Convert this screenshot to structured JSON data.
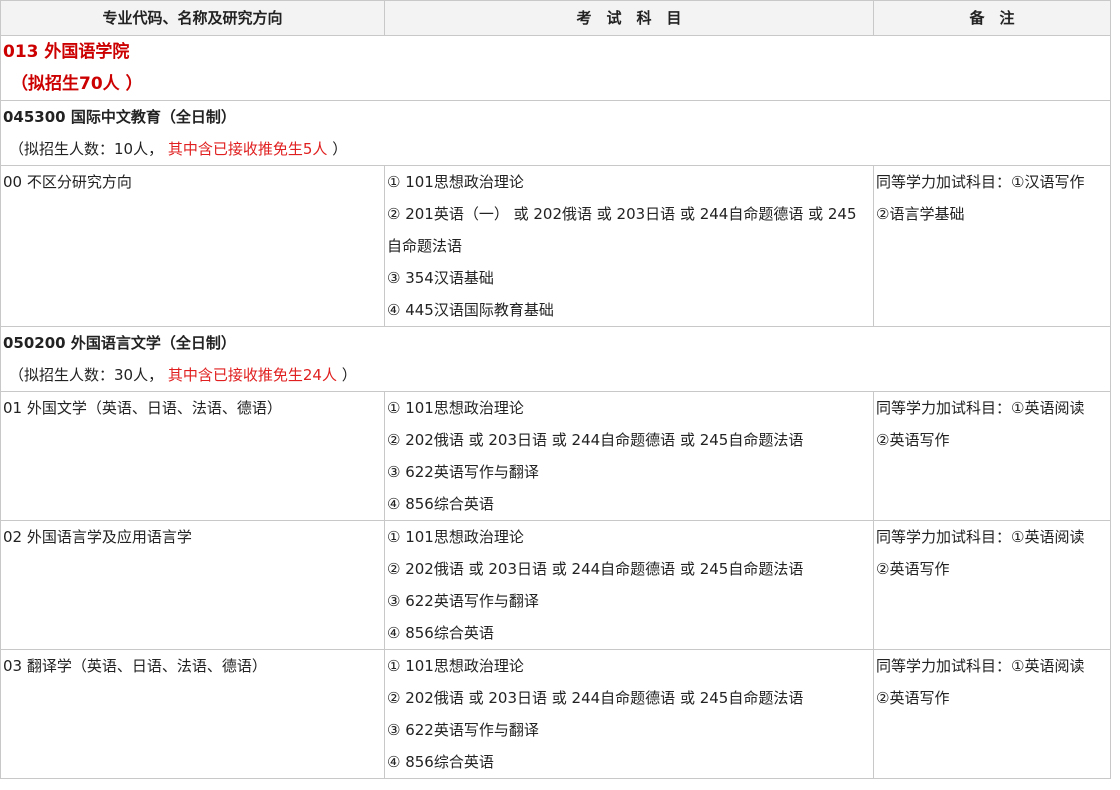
{
  "header": {
    "col1": "专业代码、名称及研究方向",
    "col2": "考　试　科　目",
    "col3": "备　注"
  },
  "college": {
    "name": "013 外国语学院",
    "quota": "（拟招生70人 ）"
  },
  "majors": [
    {
      "title": "045300 国际中文教育（全日制）",
      "quota_prefix": "（拟招生人数：10人，",
      "quota_red": "其中含已接收推免生5人",
      "quota_suffix": "）",
      "directions": [
        {
          "name": "00 不区分研究方向",
          "subjects": [
            "① 101思想政治理论",
            "② 201英语（一） 或 202俄语 或 203日语 或 244自命题德语 或 245自命题法语",
            "③ 354汉语基础",
            "④ 445汉语国际教育基础"
          ],
          "note": [
            "同等学力加试科目：①汉语写作",
            "②语言学基础"
          ]
        }
      ]
    },
    {
      "title": "050200 外国语言文学（全日制）",
      "quota_prefix": "（拟招生人数：30人，",
      "quota_red": "其中含已接收推免生24人",
      "quota_suffix": "）",
      "directions": [
        {
          "name": "01 外国文学（英语、日语、法语、德语）",
          "subjects": [
            "① 101思想政治理论",
            "② 202俄语 或 203日语 或 244自命题德语 或 245自命题法语",
            "③ 622英语写作与翻译",
            "④ 856综合英语"
          ],
          "note": [
            "同等学力加试科目：①英语阅读",
            "②英语写作"
          ]
        },
        {
          "name": "02 外国语言学及应用语言学",
          "subjects": [
            "① 101思想政治理论",
            "② 202俄语 或 203日语 或 244自命题德语 或 245自命题法语",
            "③ 622英语写作与翻译",
            "④ 856综合英语"
          ],
          "note": [
            "同等学力加试科目：①英语阅读",
            "②英语写作"
          ]
        },
        {
          "name": "03 翻译学（英语、日语、法语、德语）",
          "subjects": [
            "① 101思想政治理论",
            "② 202俄语 或 203日语 或 244自命题德语 或 245自命题法语",
            "③ 622英语写作与翻译",
            "④ 856综合英语"
          ],
          "note": [
            "同等学力加试科目：①英语阅读",
            "②英语写作"
          ]
        }
      ]
    }
  ]
}
